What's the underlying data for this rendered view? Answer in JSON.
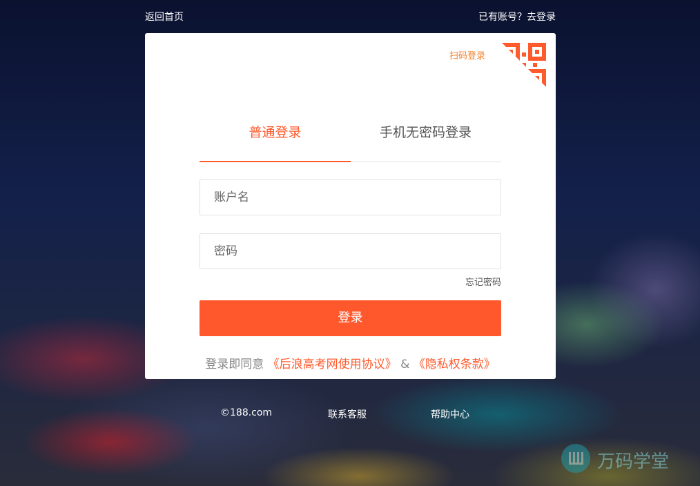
{
  "header": {
    "back_home": "返回首页",
    "have_account": "已有账号？去登录"
  },
  "card": {
    "qr_login_label": "扫码登录",
    "qr_icon": "qr-code-icon",
    "tabs": [
      {
        "label": "普通登录",
        "active": true
      },
      {
        "label": "手机无密码登录",
        "active": false
      }
    ],
    "fields": {
      "account_placeholder": "账户名",
      "password_placeholder": "密码"
    },
    "forgot_password": "忘记密码",
    "login_button": "登录",
    "agreement": {
      "prefix": "登录即同意",
      "terms": "《后浪高考网使用协议》",
      "amp": "&",
      "privacy": "《隐私权条款》"
    }
  },
  "footer": {
    "copyright": "©188.com",
    "customer_service": "联系客服",
    "help_center": "帮助中心"
  },
  "watermark": {
    "text": "万码学堂"
  },
  "colors": {
    "accent": "#ff5a2c",
    "qr_orange": "#f0822c"
  }
}
